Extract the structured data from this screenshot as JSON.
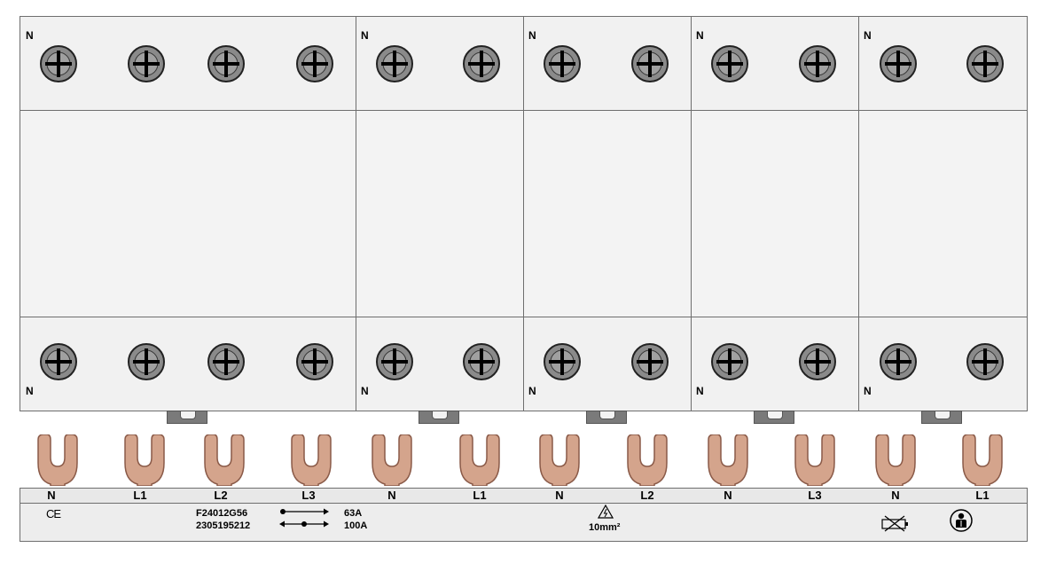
{
  "modules": [
    {
      "n_top": "N",
      "n_bottom": "N"
    },
    {
      "n_top": "N",
      "n_bottom": "N"
    },
    {
      "n_top": "N",
      "n_bottom": "N"
    },
    {
      "n_top": "N",
      "n_bottom": "N"
    },
    {
      "n_top": "N",
      "n_bottom": "N"
    }
  ],
  "busbar": {
    "connections": [
      "N",
      "L1",
      "L2",
      "L3",
      "N",
      "L1",
      "N",
      "L2",
      "N",
      "L3",
      "N",
      "L1"
    ],
    "ce_mark": "CE",
    "part_number": "F24012G56",
    "serial_number": "2305195212",
    "current_rated": "63A",
    "current_max": "100A",
    "cross_section": "10mm²"
  },
  "colors": {
    "fork": "#d4a48c",
    "fork_outline": "#8a5a48",
    "screw_fill": "#8a8a8a",
    "module_fill": "#f3f3f3"
  },
  "icons": [
    "screw-icon",
    "busbar-fork-icon",
    "arrow-right-icon",
    "arrow-double-icon",
    "warning-voltage-icon",
    "no-battery-disposal-icon",
    "electrician-icon"
  ]
}
